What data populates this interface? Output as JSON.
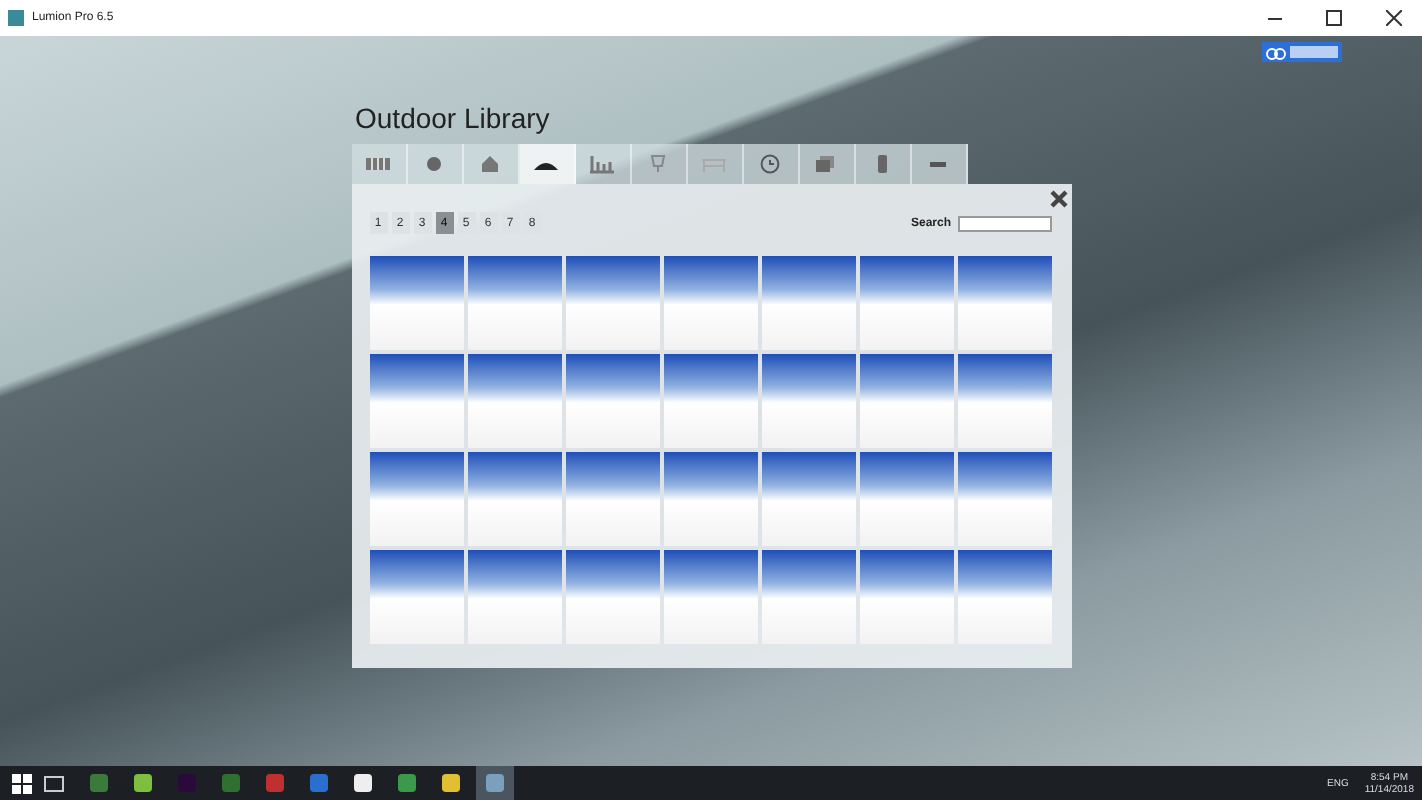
{
  "window": {
    "title": "Lumion Pro 6.5"
  },
  "library": {
    "title": "Outdoor Library",
    "search_label": "Search"
  },
  "tabs": [
    {
      "kind": "fence",
      "selected": false
    },
    {
      "kind": "ball",
      "selected": false
    },
    {
      "kind": "house",
      "selected": false
    },
    {
      "kind": "mound",
      "selected": true
    },
    {
      "kind": "bars",
      "selected": false
    },
    {
      "kind": "lamp",
      "selected": false
    },
    {
      "kind": "bench",
      "selected": false
    },
    {
      "kind": "clock",
      "selected": false
    },
    {
      "kind": "cards",
      "selected": false
    },
    {
      "kind": "bin",
      "selected": false
    },
    {
      "kind": "bar",
      "selected": false
    }
  ],
  "pages": [
    {
      "label": "1",
      "selected": false
    },
    {
      "label": "2",
      "selected": false
    },
    {
      "label": "3",
      "selected": false
    },
    {
      "label": "4",
      "selected": true
    },
    {
      "label": "5",
      "selected": false
    },
    {
      "label": "6",
      "selected": false
    },
    {
      "label": "7",
      "selected": false
    },
    {
      "label": "8",
      "selected": false
    }
  ],
  "taskbar": {
    "language": "ENG",
    "time": "8:54 PM",
    "date": "11/14/2018"
  }
}
